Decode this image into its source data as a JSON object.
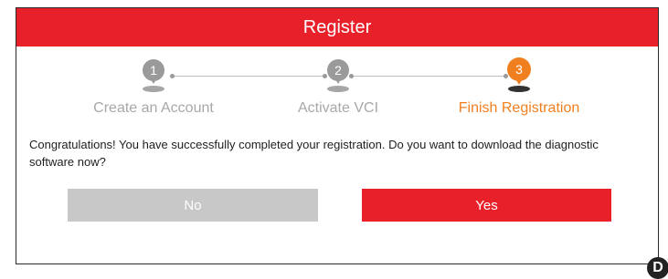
{
  "dialog": {
    "title": "Register",
    "steps": [
      {
        "number": "1",
        "label": "Create an Account",
        "state": "inactive",
        "icon": "location-pin-icon"
      },
      {
        "number": "2",
        "label": "Activate VCI",
        "state": "inactive",
        "icon": "location-pin-icon"
      },
      {
        "number": "3",
        "label": "Finish Registration",
        "state": "active",
        "icon": "location-pin-icon"
      }
    ],
    "message": "Congratulations! You have successfully completed your registration. Do you want to download the diagnostic software now?",
    "buttons": {
      "no": "No",
      "yes": "Yes"
    }
  },
  "corner_badge": "D",
  "colors": {
    "header": "#e8202a",
    "active_step": "#f07f1f",
    "inactive_step": "#9a9a9a",
    "no_button": "#c8c8c8",
    "yes_button": "#e8202a"
  }
}
